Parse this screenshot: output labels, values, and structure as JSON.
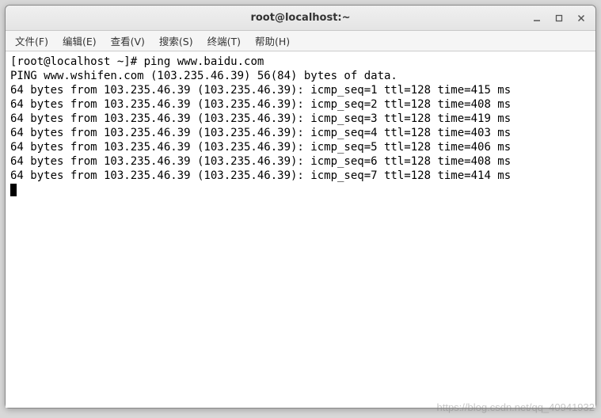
{
  "titlebar": {
    "title": "root@localhost:~"
  },
  "menu": {
    "items": [
      {
        "label": "文件(F)"
      },
      {
        "label": "编辑(E)"
      },
      {
        "label": "查看(V)"
      },
      {
        "label": "搜索(S)"
      },
      {
        "label": "终端(T)"
      },
      {
        "label": "帮助(H)"
      }
    ]
  },
  "terminal": {
    "prompt": "[root@localhost ~]# ",
    "command": "ping www.baidu.com",
    "header": "PING www.wshifen.com (103.235.46.39) 56(84) bytes of data.",
    "lines": [
      "64 bytes from 103.235.46.39 (103.235.46.39): icmp_seq=1 ttl=128 time=415 ms",
      "64 bytes from 103.235.46.39 (103.235.46.39): icmp_seq=2 ttl=128 time=408 ms",
      "64 bytes from 103.235.46.39 (103.235.46.39): icmp_seq=3 ttl=128 time=419 ms",
      "64 bytes from 103.235.46.39 (103.235.46.39): icmp_seq=4 ttl=128 time=403 ms",
      "64 bytes from 103.235.46.39 (103.235.46.39): icmp_seq=5 ttl=128 time=406 ms",
      "64 bytes from 103.235.46.39 (103.235.46.39): icmp_seq=6 ttl=128 time=408 ms",
      "64 bytes from 103.235.46.39 (103.235.46.39): icmp_seq=7 ttl=128 time=414 ms"
    ]
  },
  "watermark": "https://blog.csdn.net/qq_40941932"
}
